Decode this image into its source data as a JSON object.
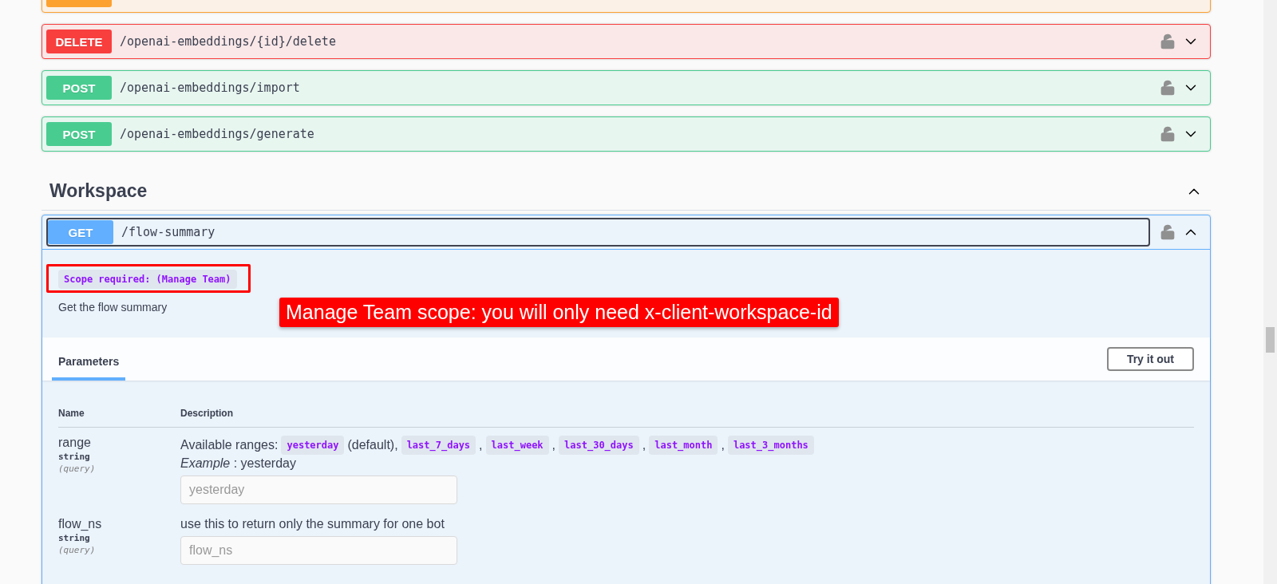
{
  "operations_above": [
    {
      "kind": "put"
    },
    {
      "kind": "delete",
      "label": "DELETE",
      "path": "/openai-embeddings/{id}/delete",
      "expanded": false
    },
    {
      "kind": "post",
      "label": "POST",
      "path": "/openai-embeddings/import",
      "expanded": false
    },
    {
      "kind": "post",
      "label": "POST",
      "path": "/openai-embeddings/generate",
      "expanded": false
    }
  ],
  "section": {
    "title": "Workspace",
    "expanded": true,
    "operation": {
      "kind": "get",
      "label": "GET",
      "path": "/flow-summary",
      "expanded": true,
      "scope": "Scope required: (Manage Team)",
      "summary": "Get the flow summary",
      "tabs": [
        {
          "label": "Parameters",
          "selected": true
        }
      ],
      "try_button": "Try it out",
      "columns": [
        "Name",
        "Description"
      ],
      "parameters": [
        {
          "name": "range",
          "type": "string",
          "location": "(query)",
          "description_parts": [
            {
              "kind": "text",
              "text": "Available ranges:"
            },
            {
              "kind": "code",
              "text": "yesterday"
            },
            {
              "kind": "text",
              "text": "(default),"
            },
            {
              "kind": "code",
              "text": "last_7_days"
            },
            {
              "kind": "text",
              "text": ","
            },
            {
              "kind": "code",
              "text": "last_week"
            },
            {
              "kind": "text",
              "text": ","
            },
            {
              "kind": "code",
              "text": "last_30_days"
            },
            {
              "kind": "text",
              "text": ","
            },
            {
              "kind": "code",
              "text": "last_month"
            },
            {
              "kind": "text",
              "text": ","
            },
            {
              "kind": "code",
              "text": "last_3_months"
            }
          ],
          "example": "*Example* : yesterday",
          "placeholder": "yesterday"
        },
        {
          "name": "flow_ns",
          "type": "string",
          "location": "(query)",
          "description_parts": [
            {
              "kind": "text",
              "text": "use this to return only the summary for one bot"
            }
          ],
          "placeholder": "flow_ns"
        }
      ]
    }
  },
  "annotation": "Manage Team scope: you will only need x-client-workspace-id"
}
